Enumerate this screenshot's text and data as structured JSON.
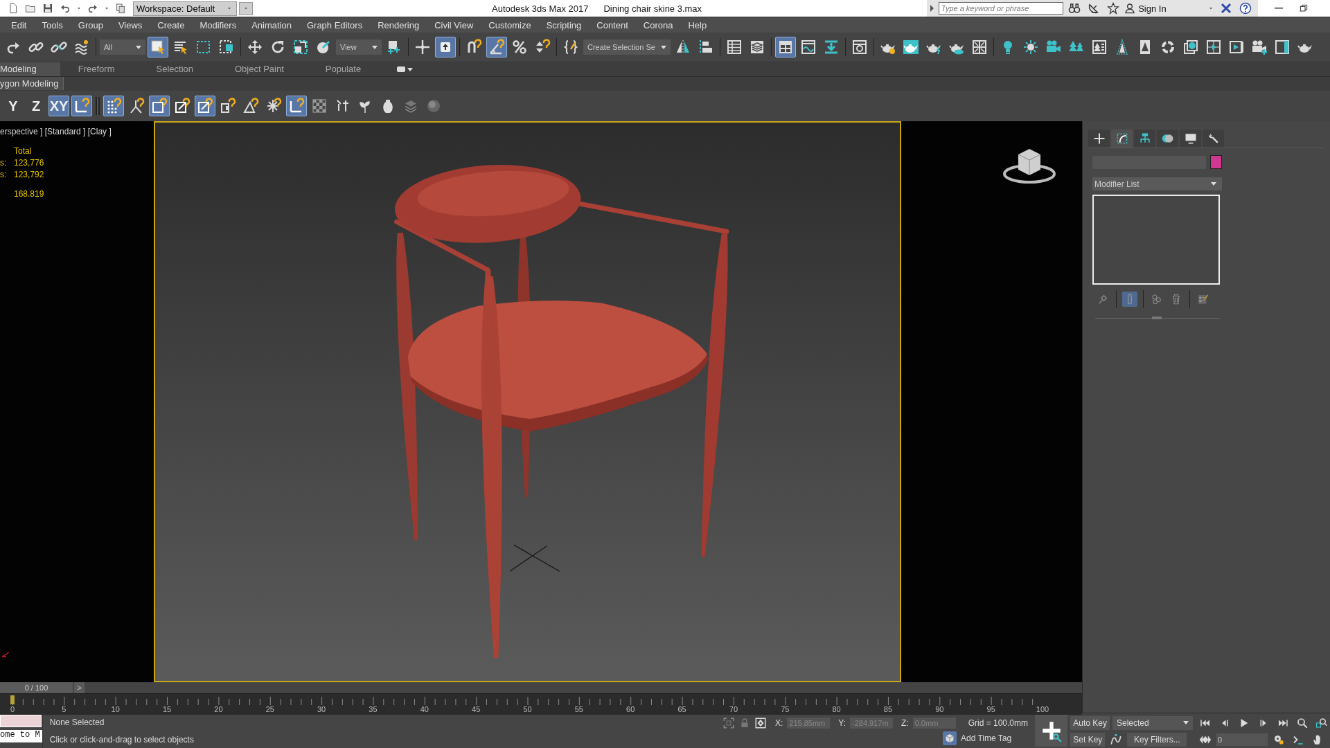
{
  "title_bar": {
    "workspace": "Workspace: Default",
    "app_title": "Autodesk 3ds Max 2017",
    "file_name": "Dining chair skine 3.max",
    "search": {
      "placeholder": "Type a keyword or phrase"
    },
    "sign_in": "Sign In"
  },
  "menu": [
    "Edit",
    "Tools",
    "Group",
    "Views",
    "Create",
    "Modifiers",
    "Animation",
    "Graph Editors",
    "Rendering",
    "Civil View",
    "Customize",
    "Scripting",
    "Content",
    "Corona",
    "Help"
  ],
  "main_toolbar": [
    {
      "kind": "tool",
      "on": false
    },
    {
      "kind": "tool",
      "on": false
    },
    {
      "kind": "tool",
      "on": false
    },
    {
      "kind": "tool",
      "on": false
    },
    {
      "kind": "sep"
    },
    {
      "kind": "dropdown",
      "value": "All"
    },
    {
      "kind": "tool",
      "on": true
    },
    {
      "kind": "tool",
      "on": false
    },
    {
      "kind": "tool",
      "on": false
    },
    {
      "kind": "tool",
      "on": false
    },
    {
      "kind": "sep"
    },
    {
      "kind": "tool",
      "on": false
    },
    {
      "kind": "tool",
      "on": false
    },
    {
      "kind": "tool",
      "on": false
    },
    {
      "kind": "tool",
      "on": false
    },
    {
      "kind": "dropdown",
      "value": "View"
    },
    {
      "kind": "tool",
      "on": false
    },
    {
      "kind": "sep"
    },
    {
      "kind": "tool",
      "on": false
    },
    {
      "kind": "tool",
      "on": true
    },
    {
      "kind": "sep"
    },
    {
      "kind": "tool",
      "on": false
    },
    {
      "kind": "tool",
      "on": true
    },
    {
      "kind": "tool",
      "on": false
    },
    {
      "kind": "tool",
      "on": false
    },
    {
      "kind": "sep"
    },
    {
      "kind": "tool",
      "on": false
    },
    {
      "kind": "dropdown",
      "value": "Create Selection Se"
    },
    {
      "kind": "tool",
      "on": false
    },
    {
      "kind": "tool",
      "on": false
    },
    {
      "kind": "sep"
    },
    {
      "kind": "tool",
      "on": false
    },
    {
      "kind": "tool",
      "on": false
    },
    {
      "kind": "sep"
    },
    {
      "kind": "tool",
      "on": true
    },
    {
      "kind": "tool",
      "on": false
    },
    {
      "kind": "tool",
      "on": false
    },
    {
      "kind": "sep"
    },
    {
      "kind": "tool",
      "on": false
    },
    {
      "kind": "sep"
    },
    {
      "kind": "tool",
      "on": false
    },
    {
      "kind": "tool",
      "on": false
    },
    {
      "kind": "tool",
      "on": false
    },
    {
      "kind": "tool",
      "on": false
    },
    {
      "kind": "tool",
      "on": false
    },
    {
      "kind": "sep"
    },
    {
      "kind": "tool",
      "on": false
    },
    {
      "kind": "tool",
      "on": false
    },
    {
      "kind": "tool",
      "on": false
    },
    {
      "kind": "tool",
      "on": false
    },
    {
      "kind": "tool",
      "on": false
    },
    {
      "kind": "tool",
      "on": false
    },
    {
      "kind": "tool",
      "on": false
    },
    {
      "kind": "tool",
      "on": false
    },
    {
      "kind": "tool",
      "on": false
    },
    {
      "kind": "tool",
      "on": false
    },
    {
      "kind": "tool",
      "on": false
    },
    {
      "kind": "tool",
      "on": false
    },
    {
      "kind": "tool",
      "on": false
    },
    {
      "kind": "tool",
      "on": false
    }
  ],
  "ribbon_tabs": [
    {
      "label": "Modeling",
      "selected": true
    },
    {
      "label": "Freeform",
      "selected": false
    },
    {
      "label": "Selection",
      "selected": false
    },
    {
      "label": "Object Paint",
      "selected": false
    },
    {
      "label": "Populate",
      "selected": false
    }
  ],
  "ribbon_panel": "ygon Modeling",
  "ribbon_toolbar": [
    {
      "kind": "text",
      "label": "Y",
      "on": false
    },
    {
      "kind": "text",
      "label": "Z",
      "on": false
    },
    {
      "kind": "text",
      "label": "XY",
      "on": true
    },
    {
      "kind": "tool",
      "on": true
    },
    {
      "kind": "sep"
    },
    {
      "kind": "tool",
      "on": true
    },
    {
      "kind": "tool",
      "on": false
    },
    {
      "kind": "tool",
      "on": true
    },
    {
      "kind": "tool",
      "on": false
    },
    {
      "kind": "tool",
      "on": true
    },
    {
      "kind": "tool",
      "on": false
    },
    {
      "kind": "tool",
      "on": false
    },
    {
      "kind": "tool",
      "on": false
    },
    {
      "kind": "tool",
      "on": true
    },
    {
      "kind": "tool",
      "on": false
    },
    {
      "kind": "tool",
      "on": false
    },
    {
      "kind": "tool",
      "on": false
    },
    {
      "kind": "tool",
      "on": false
    },
    {
      "kind": "tool",
      "on": false
    },
    {
      "kind": "tool",
      "on": false
    }
  ],
  "left_viewport": {
    "label": "erspective ] [Standard ] [Clay ]",
    "stat_groups": [
      [
        {
          "value": "Total"
        },
        {
          "label": "s:",
          "value": "123,776"
        },
        {
          "label": "s:",
          "value": "123,792"
        }
      ],
      [
        {
          "value": "168.819"
        }
      ]
    ]
  },
  "command_panel": {
    "tabs": [
      {
        "selected": false
      },
      {
        "selected": true
      },
      {
        "selected": false
      },
      {
        "selected": false
      },
      {
        "selected": false
      },
      {
        "selected": false
      }
    ],
    "modifier_list": "Modifier List",
    "stack_buttons": [
      {
        "on": false
      },
      {
        "on": true
      },
      {
        "on": false
      },
      {
        "on": false
      },
      {
        "on": false
      }
    ]
  },
  "time_slider": {
    "frame": "0 / 100",
    "next": ">",
    "level": 0
  },
  "track_ticks": [
    "0",
    "5",
    "10",
    "15",
    "20",
    "25",
    "30",
    "35",
    "40",
    "45",
    "50",
    "55",
    "60",
    "65",
    "70",
    "75",
    "80",
    "85",
    "90",
    "95",
    "100"
  ],
  "status_bar": {
    "listener": "ome to M",
    "selection": "None Selected",
    "prompt": "Click or click-and-drag to select objects",
    "x_label": "X:",
    "x": "215.85mm",
    "y_label": "Y:",
    "y": "-284.917m",
    "z_label": "Z:",
    "z": "0.0mm",
    "grid": "Grid = 100.0mm",
    "time_tag": "Add Time Tag",
    "auto_key": "Auto Key",
    "key_mode": "Selected",
    "set_key": "Set Key",
    "key_filters": "Key Filters...",
    "frame": "0"
  }
}
